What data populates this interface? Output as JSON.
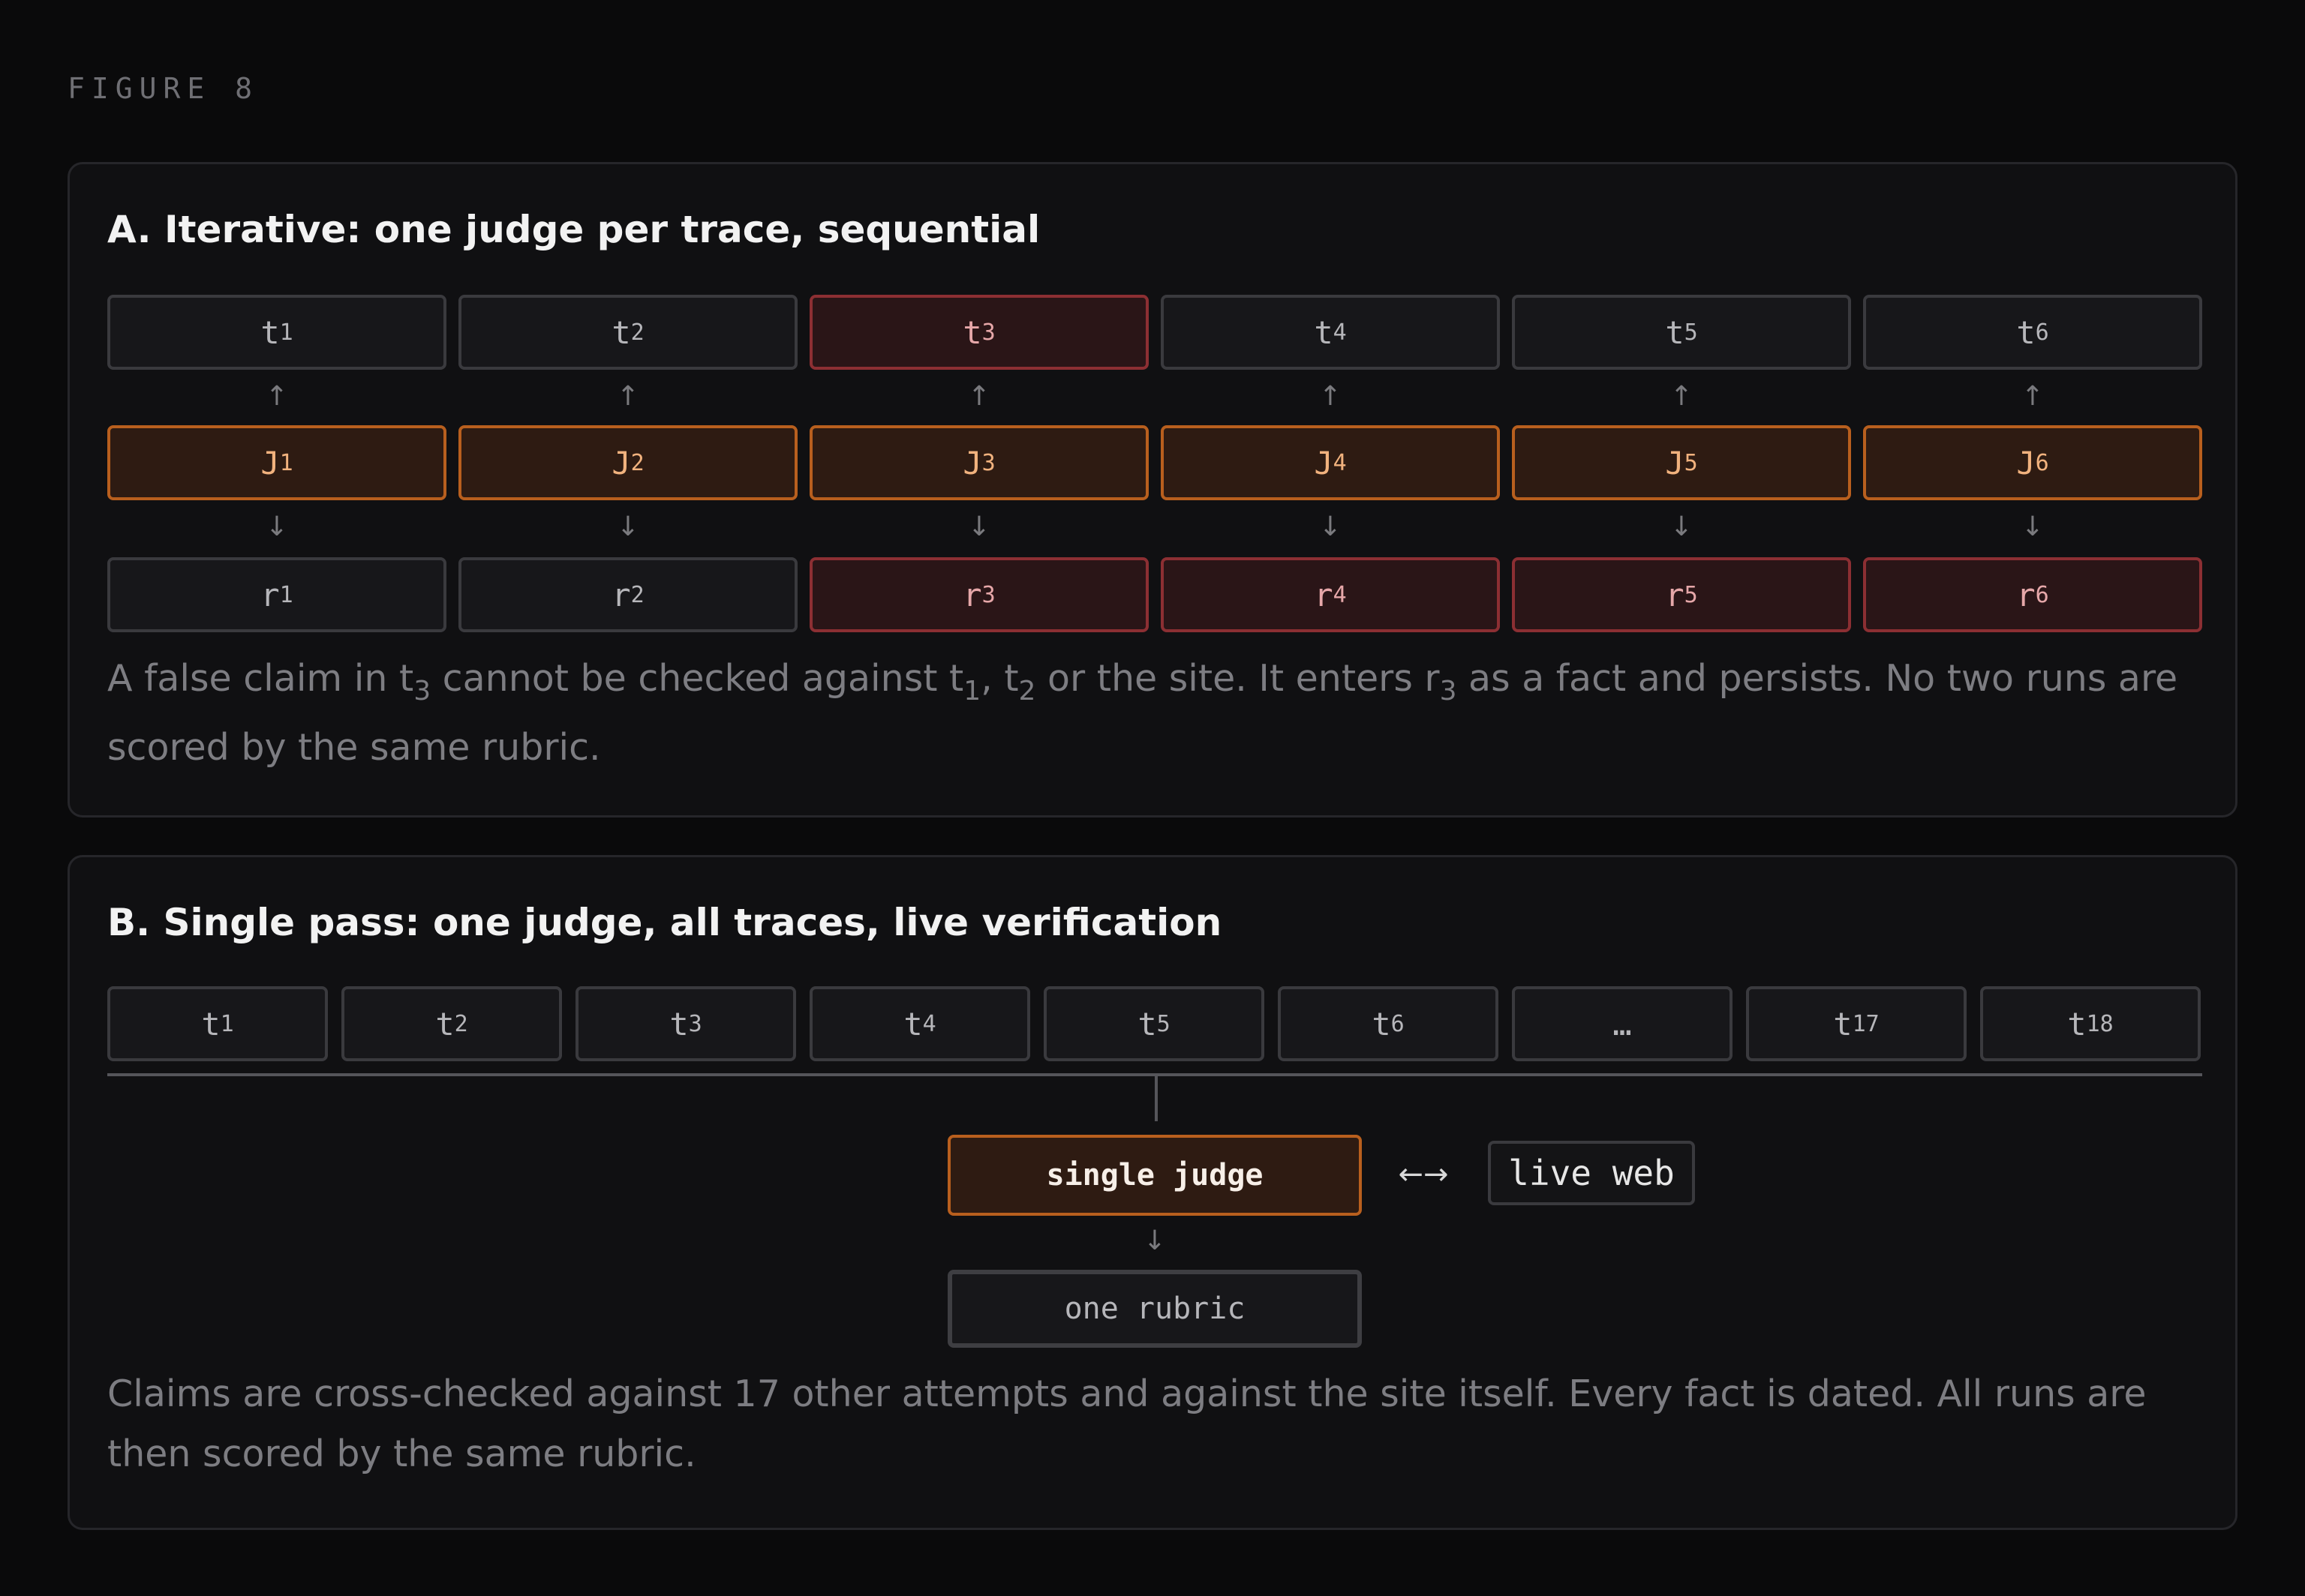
{
  "figure_label": "FIGURE 8",
  "panel_a": {
    "title": "A. Iterative: one judge per trace, sequential",
    "traces": [
      {
        "base": "t",
        "sub": "1",
        "flag": false
      },
      {
        "base": "t",
        "sub": "2",
        "flag": false
      },
      {
        "base": "t",
        "sub": "3",
        "flag": true
      },
      {
        "base": "t",
        "sub": "4",
        "flag": false
      },
      {
        "base": "t",
        "sub": "5",
        "flag": false
      },
      {
        "base": "t",
        "sub": "6",
        "flag": false
      }
    ],
    "judges": [
      {
        "base": "J",
        "sub": "1"
      },
      {
        "base": "J",
        "sub": "2"
      },
      {
        "base": "J",
        "sub": "3"
      },
      {
        "base": "J",
        "sub": "4"
      },
      {
        "base": "J",
        "sub": "5"
      },
      {
        "base": "J",
        "sub": "6"
      }
    ],
    "rubrics": [
      {
        "base": "r",
        "sub": "1",
        "flag": false
      },
      {
        "base": "r",
        "sub": "2",
        "flag": false
      },
      {
        "base": "r",
        "sub": "3",
        "flag": true
      },
      {
        "base": "r",
        "sub": "4",
        "flag": true
      },
      {
        "base": "r",
        "sub": "5",
        "flag": true
      },
      {
        "base": "r",
        "sub": "6",
        "flag": true
      }
    ],
    "up_arrow": "↑",
    "down_arrow": "↓",
    "caption": [
      {
        "text": "A false claim in t"
      },
      {
        "sub": "3"
      },
      {
        "text": " cannot be checked against t"
      },
      {
        "sub": "1"
      },
      {
        "text": ", t"
      },
      {
        "sub": "2"
      },
      {
        "text": " or the site. It enters r"
      },
      {
        "sub": "3"
      },
      {
        "text": " as a fact and persists. No two runs are scored by the same rubric."
      }
    ]
  },
  "panel_b": {
    "title": "B. Single pass: one judge, all traces, live verification",
    "traces": [
      {
        "base": "t",
        "sub": "1"
      },
      {
        "base": "t",
        "sub": "2"
      },
      {
        "base": "t",
        "sub": "3"
      },
      {
        "base": "t",
        "sub": "4"
      },
      {
        "base": "t",
        "sub": "5"
      },
      {
        "base": "t",
        "sub": "6"
      },
      {
        "base": "…",
        "sub": ""
      },
      {
        "base": "t",
        "sub": "17"
      },
      {
        "base": "t",
        "sub": "18"
      }
    ],
    "judge_label": "single judge",
    "bidirectional_arrow": "←→",
    "web_label": "live web",
    "down_arrow": "↓",
    "rubric_label": "one rubric",
    "caption": "Claims are cross-checked against 17 other attempts and against the site itself. Every fact is dated. All runs are then scored by the same rubric."
  }
}
